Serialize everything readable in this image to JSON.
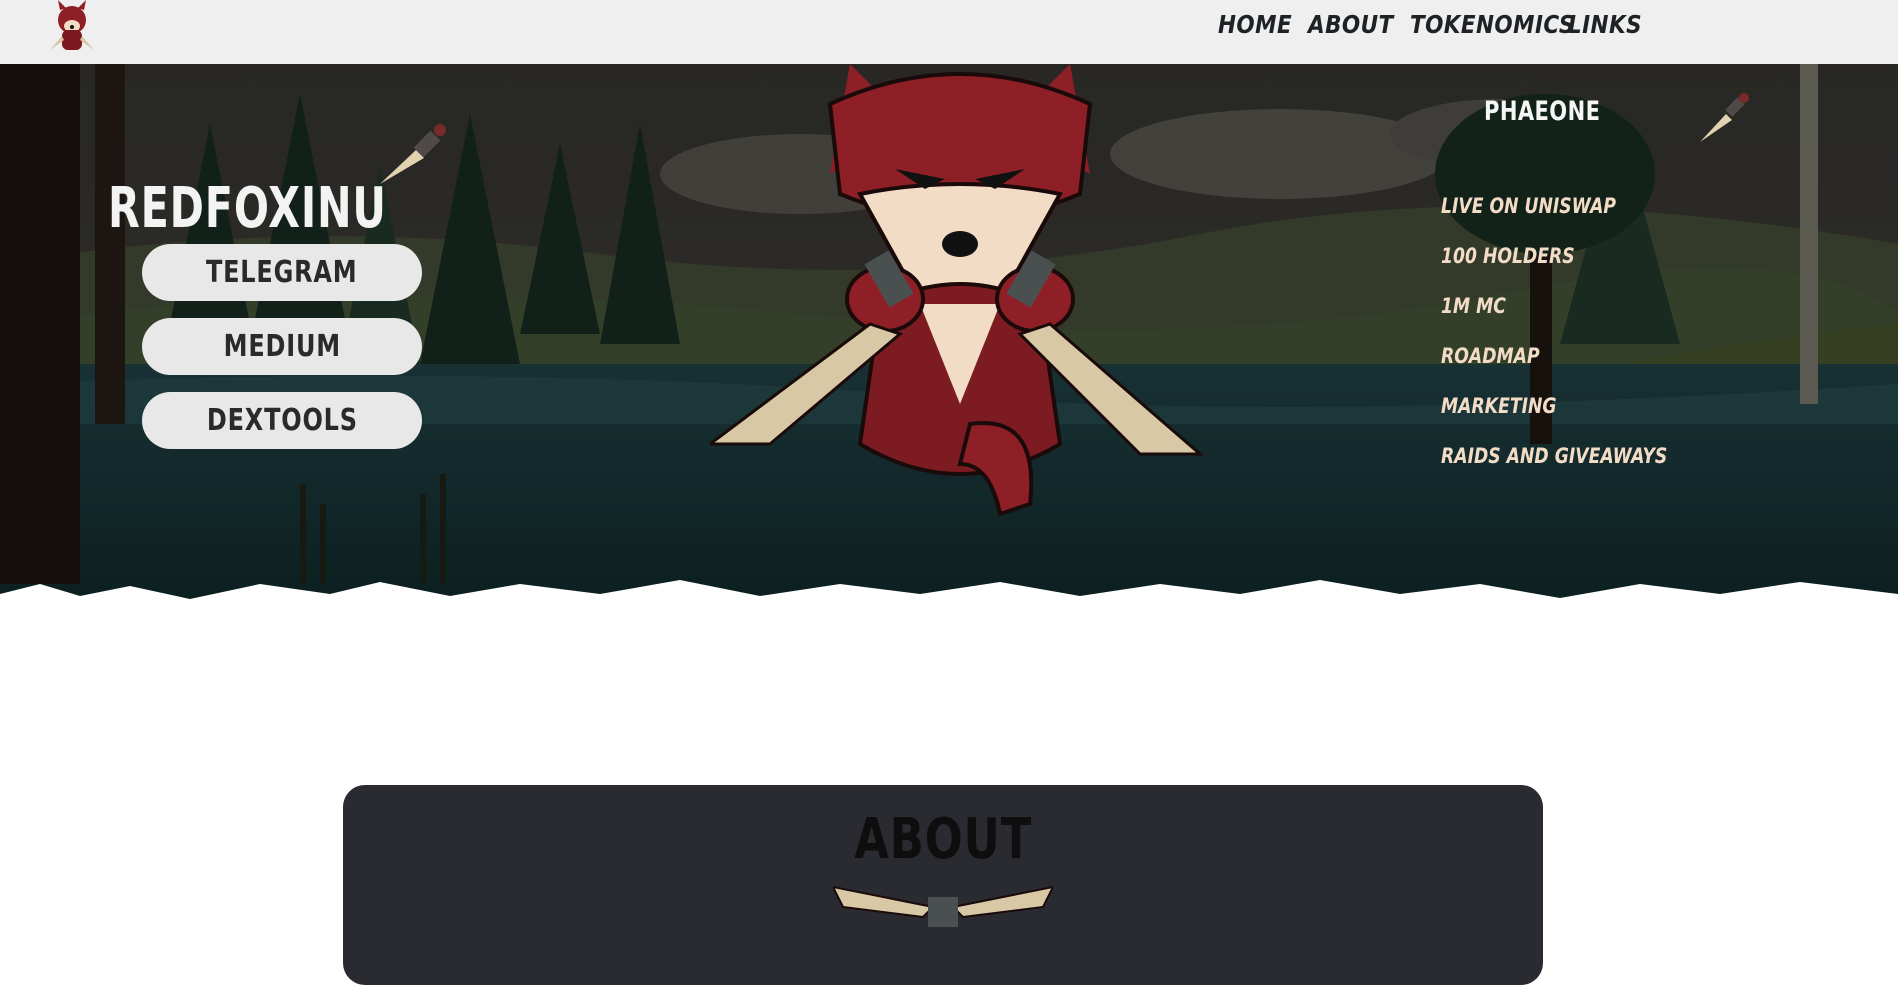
{
  "nav": {
    "items": [
      {
        "label": "HOME"
      },
      {
        "label": "ABOUT"
      },
      {
        "label": "TOKENOMICS"
      },
      {
        "label": "LINKS"
      }
    ]
  },
  "hero": {
    "brand": "REDFOXINU",
    "links": [
      {
        "label": "TELEGRAM"
      },
      {
        "label": "MEDIUM"
      },
      {
        "label": "DEXTOOLS"
      }
    ],
    "roadmap": {
      "title": "PHAEONE",
      "items": [
        {
          "label": "LIVE ON UNISWAP"
        },
        {
          "label": "100 HOLDERS"
        },
        {
          "label": "1M MC"
        },
        {
          "label": "ROADMAP"
        },
        {
          "label": "MARKETING"
        },
        {
          "label": "RAIDS AND GIVEAWAYS"
        }
      ]
    }
  },
  "about": {
    "title": "ABOUT"
  },
  "colors": {
    "topbar": "#efefef",
    "fox_red": "#8e1f26",
    "cream": "#f3dcc6",
    "card": "#2a2b30"
  },
  "icons": [
    "fox-logo-icon",
    "dagger-icon",
    "crossed-daggers-icon"
  ]
}
